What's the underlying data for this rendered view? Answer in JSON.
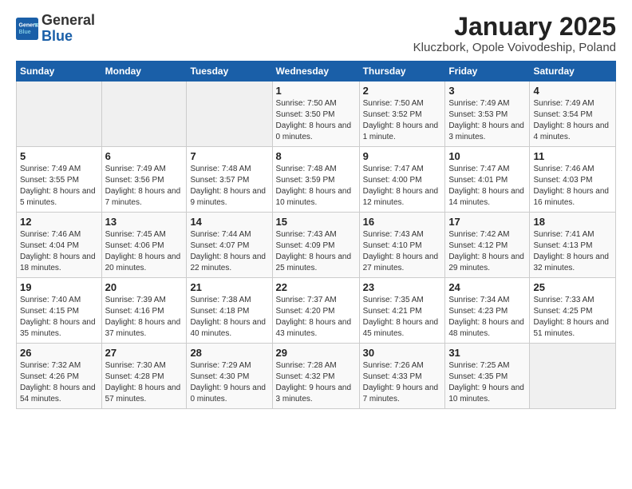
{
  "header": {
    "logo_general": "General",
    "logo_blue": "Blue",
    "title": "January 2025",
    "subtitle": "Kluczbork, Opole Voivodeship, Poland"
  },
  "days_of_week": [
    "Sunday",
    "Monday",
    "Tuesday",
    "Wednesday",
    "Thursday",
    "Friday",
    "Saturday"
  ],
  "weeks": [
    [
      {
        "day": "",
        "text": ""
      },
      {
        "day": "",
        "text": ""
      },
      {
        "day": "",
        "text": ""
      },
      {
        "day": "1",
        "text": "Sunrise: 7:50 AM\nSunset: 3:50 PM\nDaylight: 8 hours and 0 minutes."
      },
      {
        "day": "2",
        "text": "Sunrise: 7:50 AM\nSunset: 3:52 PM\nDaylight: 8 hours and 1 minute."
      },
      {
        "day": "3",
        "text": "Sunrise: 7:49 AM\nSunset: 3:53 PM\nDaylight: 8 hours and 3 minutes."
      },
      {
        "day": "4",
        "text": "Sunrise: 7:49 AM\nSunset: 3:54 PM\nDaylight: 8 hours and 4 minutes."
      }
    ],
    [
      {
        "day": "5",
        "text": "Sunrise: 7:49 AM\nSunset: 3:55 PM\nDaylight: 8 hours and 5 minutes."
      },
      {
        "day": "6",
        "text": "Sunrise: 7:49 AM\nSunset: 3:56 PM\nDaylight: 8 hours and 7 minutes."
      },
      {
        "day": "7",
        "text": "Sunrise: 7:48 AM\nSunset: 3:57 PM\nDaylight: 8 hours and 9 minutes."
      },
      {
        "day": "8",
        "text": "Sunrise: 7:48 AM\nSunset: 3:59 PM\nDaylight: 8 hours and 10 minutes."
      },
      {
        "day": "9",
        "text": "Sunrise: 7:47 AM\nSunset: 4:00 PM\nDaylight: 8 hours and 12 minutes."
      },
      {
        "day": "10",
        "text": "Sunrise: 7:47 AM\nSunset: 4:01 PM\nDaylight: 8 hours and 14 minutes."
      },
      {
        "day": "11",
        "text": "Sunrise: 7:46 AM\nSunset: 4:03 PM\nDaylight: 8 hours and 16 minutes."
      }
    ],
    [
      {
        "day": "12",
        "text": "Sunrise: 7:46 AM\nSunset: 4:04 PM\nDaylight: 8 hours and 18 minutes."
      },
      {
        "day": "13",
        "text": "Sunrise: 7:45 AM\nSunset: 4:06 PM\nDaylight: 8 hours and 20 minutes."
      },
      {
        "day": "14",
        "text": "Sunrise: 7:44 AM\nSunset: 4:07 PM\nDaylight: 8 hours and 22 minutes."
      },
      {
        "day": "15",
        "text": "Sunrise: 7:43 AM\nSunset: 4:09 PM\nDaylight: 8 hours and 25 minutes."
      },
      {
        "day": "16",
        "text": "Sunrise: 7:43 AM\nSunset: 4:10 PM\nDaylight: 8 hours and 27 minutes."
      },
      {
        "day": "17",
        "text": "Sunrise: 7:42 AM\nSunset: 4:12 PM\nDaylight: 8 hours and 29 minutes."
      },
      {
        "day": "18",
        "text": "Sunrise: 7:41 AM\nSunset: 4:13 PM\nDaylight: 8 hours and 32 minutes."
      }
    ],
    [
      {
        "day": "19",
        "text": "Sunrise: 7:40 AM\nSunset: 4:15 PM\nDaylight: 8 hours and 35 minutes."
      },
      {
        "day": "20",
        "text": "Sunrise: 7:39 AM\nSunset: 4:16 PM\nDaylight: 8 hours and 37 minutes."
      },
      {
        "day": "21",
        "text": "Sunrise: 7:38 AM\nSunset: 4:18 PM\nDaylight: 8 hours and 40 minutes."
      },
      {
        "day": "22",
        "text": "Sunrise: 7:37 AM\nSunset: 4:20 PM\nDaylight: 8 hours and 43 minutes."
      },
      {
        "day": "23",
        "text": "Sunrise: 7:35 AM\nSunset: 4:21 PM\nDaylight: 8 hours and 45 minutes."
      },
      {
        "day": "24",
        "text": "Sunrise: 7:34 AM\nSunset: 4:23 PM\nDaylight: 8 hours and 48 minutes."
      },
      {
        "day": "25",
        "text": "Sunrise: 7:33 AM\nSunset: 4:25 PM\nDaylight: 8 hours and 51 minutes."
      }
    ],
    [
      {
        "day": "26",
        "text": "Sunrise: 7:32 AM\nSunset: 4:26 PM\nDaylight: 8 hours and 54 minutes."
      },
      {
        "day": "27",
        "text": "Sunrise: 7:30 AM\nSunset: 4:28 PM\nDaylight: 8 hours and 57 minutes."
      },
      {
        "day": "28",
        "text": "Sunrise: 7:29 AM\nSunset: 4:30 PM\nDaylight: 9 hours and 0 minutes."
      },
      {
        "day": "29",
        "text": "Sunrise: 7:28 AM\nSunset: 4:32 PM\nDaylight: 9 hours and 3 minutes."
      },
      {
        "day": "30",
        "text": "Sunrise: 7:26 AM\nSunset: 4:33 PM\nDaylight: 9 hours and 7 minutes."
      },
      {
        "day": "31",
        "text": "Sunrise: 7:25 AM\nSunset: 4:35 PM\nDaylight: 9 hours and 10 minutes."
      },
      {
        "day": "",
        "text": ""
      }
    ]
  ]
}
